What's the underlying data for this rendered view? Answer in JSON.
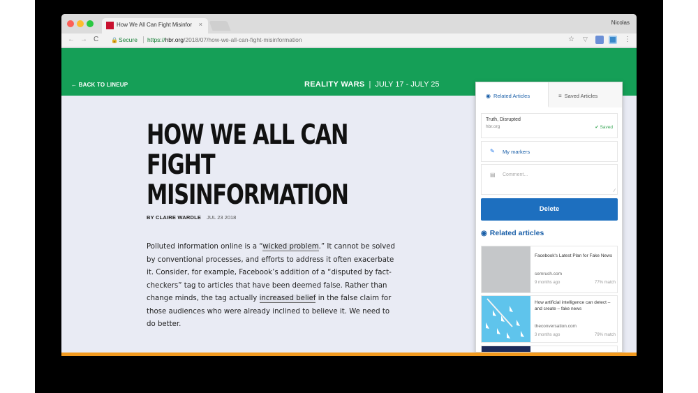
{
  "browser": {
    "tab_title": "How We All Can Fight Misinfor",
    "tab_close": "×",
    "profile_name": "Nicolas",
    "nav": {
      "back": "←",
      "forward": "→",
      "reload": "C"
    },
    "security_label": "Secure",
    "url_https": "https://",
    "url_host": "hbr.org",
    "url_path": "/2018/07/how-we-all-can-fight-misinformation",
    "colors": {
      "secure_green": "#188038"
    }
  },
  "page": {
    "back_link": "← BACK TO LINEUP",
    "section_name": "REALITY WARS",
    "section_sep": "|",
    "section_dates": "JULY 17 - JULY 25",
    "headline_line1": "HOW WE ALL CAN",
    "headline_line2": "FIGHT",
    "headline_line3": "MISINFORMATION",
    "byline_author": "BY CLAIRE WARDLE",
    "byline_date": "JUL 23 2018",
    "body_part1": "Polluted information online is a “",
    "body_link1": "wicked problem",
    "body_part2": ".” It cannot be solved by conventional processes, and efforts to address it often exacerbate it. Consider, for example, Facebook’s addition of a “disputed by fact-checkers” tag to articles that have been deemed false. Rather than change minds, the tag actually ",
    "body_link2": "increased belief",
    "body_part3": " in the false claim for those audiences who were already inclined to believe it. We need to do better.",
    "colors": {
      "header_green": "#159f57",
      "footer_orange": "#f29a1f"
    }
  },
  "extension": {
    "tab_related": "Related Articles",
    "tab_saved": "Saved Articles",
    "saved_item_title": "Truth, Disrupted",
    "saved_item_host": "hbr.org",
    "saved_status": "✔ Saved",
    "markers_label": "My markers",
    "comment_placeholder": "Comment...",
    "delete_label": "Delete",
    "related_heading": "Related articles",
    "articles": [
      {
        "title": "Facebook's Latest Plan for Fake News",
        "host": "semrush.com",
        "age": "9 months ago",
        "match": "77% match"
      },
      {
        "title": "How artificial intelligence can detect – and create – fake news",
        "host": "theconversation.com",
        "age": "3 months ago",
        "match": "79% match"
      }
    ],
    "colors": {
      "accent_blue": "#1d6fbf",
      "saved_green": "#3aa757"
    }
  }
}
